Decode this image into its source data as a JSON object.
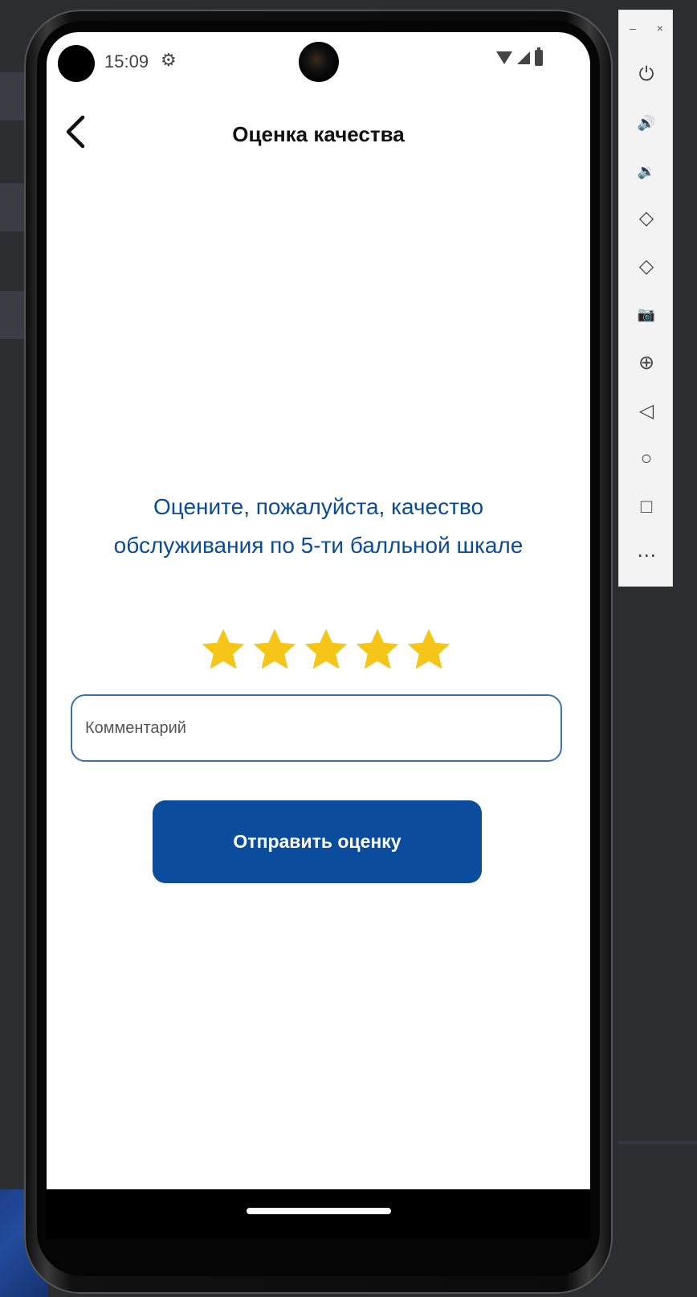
{
  "status_bar": {
    "time": "15:09",
    "settings_icon": "gear-icon",
    "wifi_icon": "wifi-icon",
    "signal_icon": "signal-icon",
    "battery_icon": "battery-icon"
  },
  "app_bar": {
    "back_icon": "chevron-left-icon",
    "title": "Оценка качества"
  },
  "rating": {
    "prompt_line1": "Оцените, пожалуйста, качество",
    "prompt_line2": "обслуживания по 5-ти балльной шкале",
    "max_stars": 5,
    "selected_stars": 5,
    "star_color": "#f5c518"
  },
  "comment": {
    "placeholder": "Комментарий",
    "value": ""
  },
  "submit": {
    "label": "Отправить оценку",
    "color": "#0b4c9c"
  },
  "emulator_toolbar": {
    "minimize": "–",
    "close": "×",
    "buttons": [
      {
        "icon": "power-icon",
        "glyph": "⏻"
      },
      {
        "icon": "volume-up-icon",
        "glyph": "🔊"
      },
      {
        "icon": "volume-down-icon",
        "glyph": "🔉"
      },
      {
        "icon": "rotate-left-icon",
        "glyph": "◇"
      },
      {
        "icon": "rotate-right-icon",
        "glyph": "◇"
      },
      {
        "icon": "camera-icon",
        "glyph": "📷"
      },
      {
        "icon": "zoom-icon",
        "glyph": "⊕"
      },
      {
        "icon": "back-icon",
        "glyph": "◁"
      },
      {
        "icon": "home-icon",
        "glyph": "○"
      },
      {
        "icon": "overview-icon",
        "glyph": "□"
      },
      {
        "icon": "more-icon",
        "glyph": "⋯"
      }
    ]
  }
}
